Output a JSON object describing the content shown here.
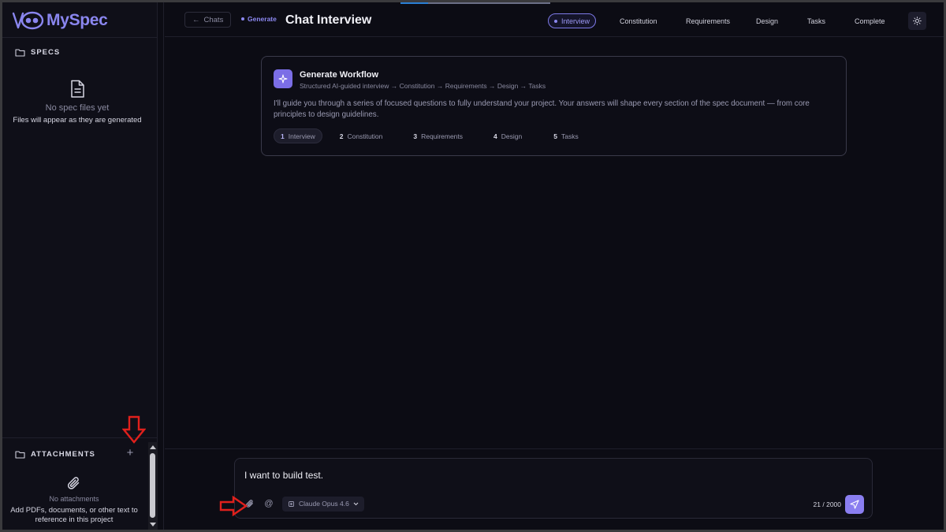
{
  "app": {
    "name": "MySpec"
  },
  "sidebar": {
    "specs": {
      "title": "SPECS",
      "empty_title": "No spec files yet",
      "empty_sub": "Files will appear as they are generated"
    },
    "attachments": {
      "title": "ATTACHMENTS",
      "add_label": "+",
      "empty_title": "No attachments",
      "empty_sub": "Add PDFs, documents, or other text to reference in this project"
    }
  },
  "header": {
    "back_label": "Chats",
    "badge": "Generate",
    "title": "Chat Interview",
    "steps": [
      {
        "label": "Interview",
        "active": true
      },
      {
        "label": "Constitution",
        "active": false
      },
      {
        "label": "Requirements",
        "active": false
      },
      {
        "label": "Design",
        "active": false
      },
      {
        "label": "Tasks",
        "active": false
      },
      {
        "label": "Complete",
        "active": false
      }
    ]
  },
  "workflow_card": {
    "title": "Generate Workflow",
    "subtitle": "Structured AI-guided interview → Constitution → Requirements → Design → Tasks",
    "body": "I'll guide you through a series of focused questions to fully understand your project. Your answers will shape every section of the spec document — from core principles to design guidelines.",
    "pills": [
      {
        "num": "1",
        "label": "Interview",
        "active": true
      },
      {
        "num": "2",
        "label": "Constitution",
        "active": false
      },
      {
        "num": "3",
        "label": "Requirements",
        "active": false
      },
      {
        "num": "4",
        "label": "Design",
        "active": false
      },
      {
        "num": "5",
        "label": "Tasks",
        "active": false
      }
    ]
  },
  "composer": {
    "value": "I want to build test.",
    "model": "Claude Opus 4.6",
    "counter": "21 / 2000"
  },
  "colors": {
    "accent": "#8c88f0",
    "annotation": "#e0201c",
    "background": "#0c0c14"
  }
}
